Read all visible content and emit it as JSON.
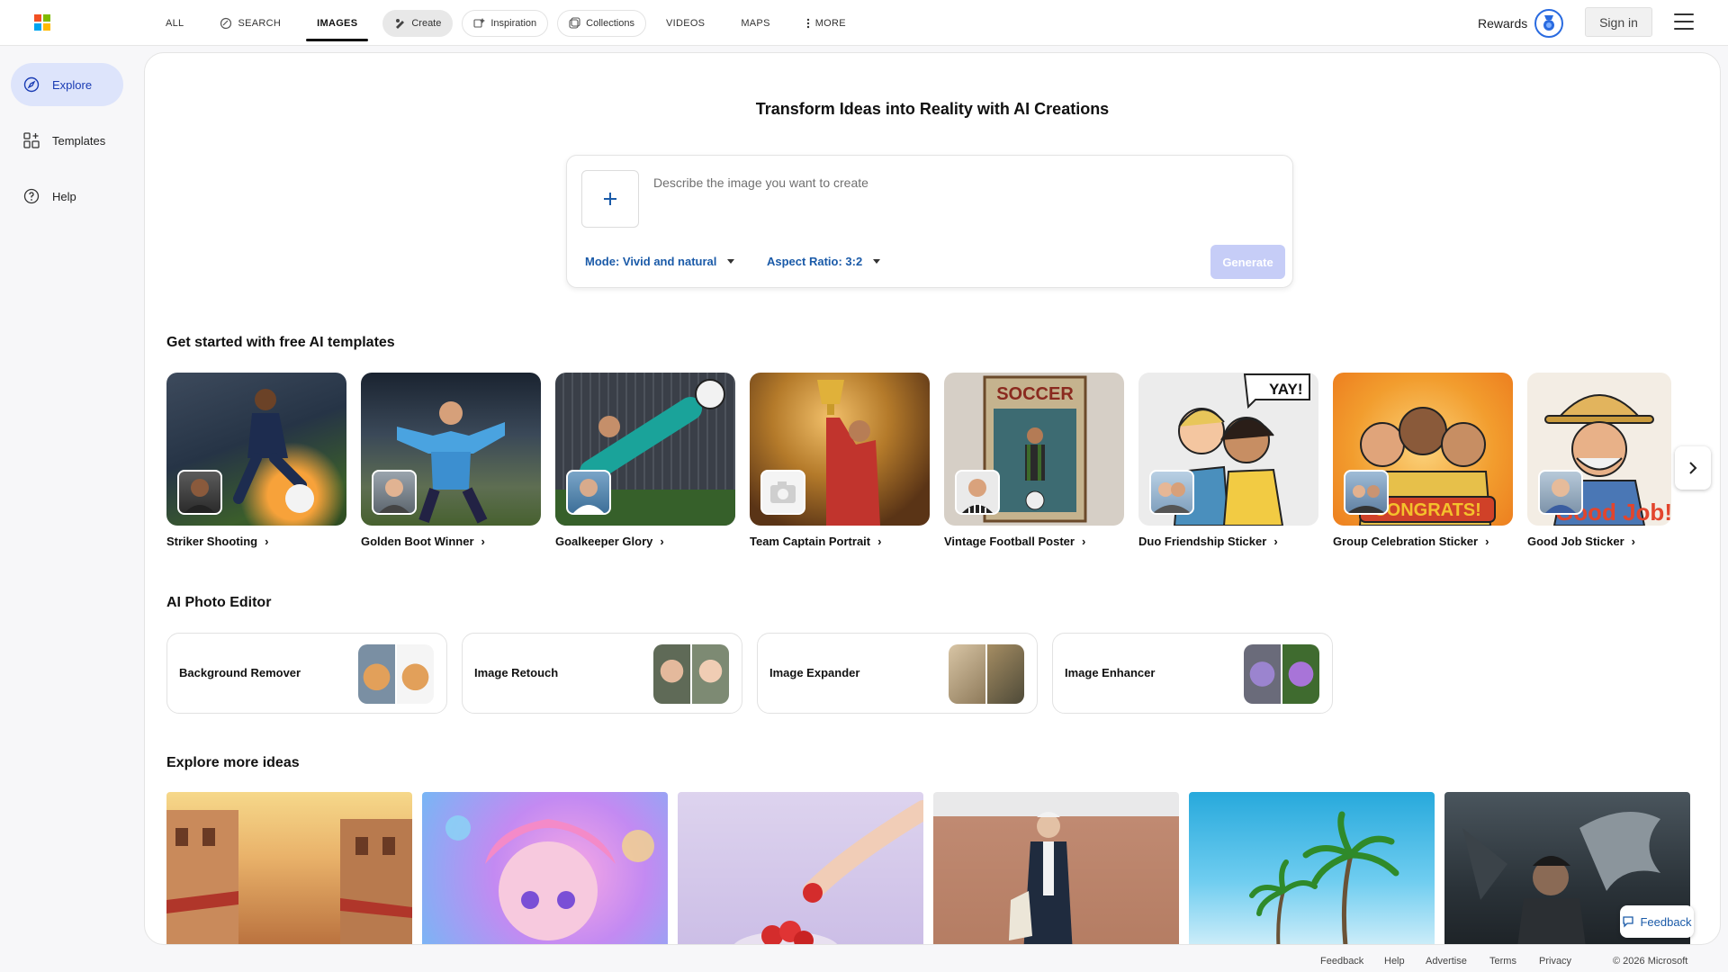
{
  "nav": {
    "all": "ALL",
    "search": "SEARCH",
    "images": "IMAGES",
    "create": "Create",
    "inspiration": "Inspiration",
    "collections": "Collections",
    "videos": "VIDEOS",
    "maps": "MAPS",
    "more": "MORE"
  },
  "header": {
    "rewards": "Rewards",
    "sign_in": "Sign in"
  },
  "sidebar": {
    "items": [
      {
        "label": "Explore",
        "icon": "compass-icon",
        "active": true
      },
      {
        "label": "Templates",
        "icon": "templates-icon",
        "active": false
      },
      {
        "label": "Help",
        "icon": "help-icon",
        "active": false
      }
    ]
  },
  "hero": {
    "title": "Transform Ideas into Reality with AI Creations",
    "placeholder": "Describe the image you want to create",
    "mode": "Mode: Vivid and natural",
    "aspect": "Aspect Ratio: 3:2",
    "generate": "Generate"
  },
  "templates": {
    "title": "Get started with free AI templates",
    "items": [
      {
        "label": "Striker Shooting"
      },
      {
        "label": "Golden Boot Winner"
      },
      {
        "label": "Goalkeeper Glory"
      },
      {
        "label": "Team Captain Portrait"
      },
      {
        "label": "Vintage Football Poster"
      },
      {
        "label": "Duo Friendship Sticker"
      },
      {
        "label": "Group Celebration Sticker"
      },
      {
        "label": "Good Job Sticker"
      }
    ]
  },
  "editor": {
    "title": "AI Photo Editor",
    "items": [
      {
        "label": "Background Remover"
      },
      {
        "label": "Image Retouch"
      },
      {
        "label": "Image Expander"
      },
      {
        "label": "Image Enhancer"
      }
    ]
  },
  "explore": {
    "title": "Explore more ideas"
  },
  "feedback_button": "Feedback",
  "footer": {
    "feedback": "Feedback",
    "help": "Help",
    "advertise": "Advertise",
    "terms": "Terms",
    "privacy": "Privacy",
    "copyright": "© 2026 Microsoft"
  },
  "colors": {
    "accent": "#1a5aa8",
    "active_bg": "#dde4fb",
    "generate_disabled": "#c6cdf7"
  }
}
